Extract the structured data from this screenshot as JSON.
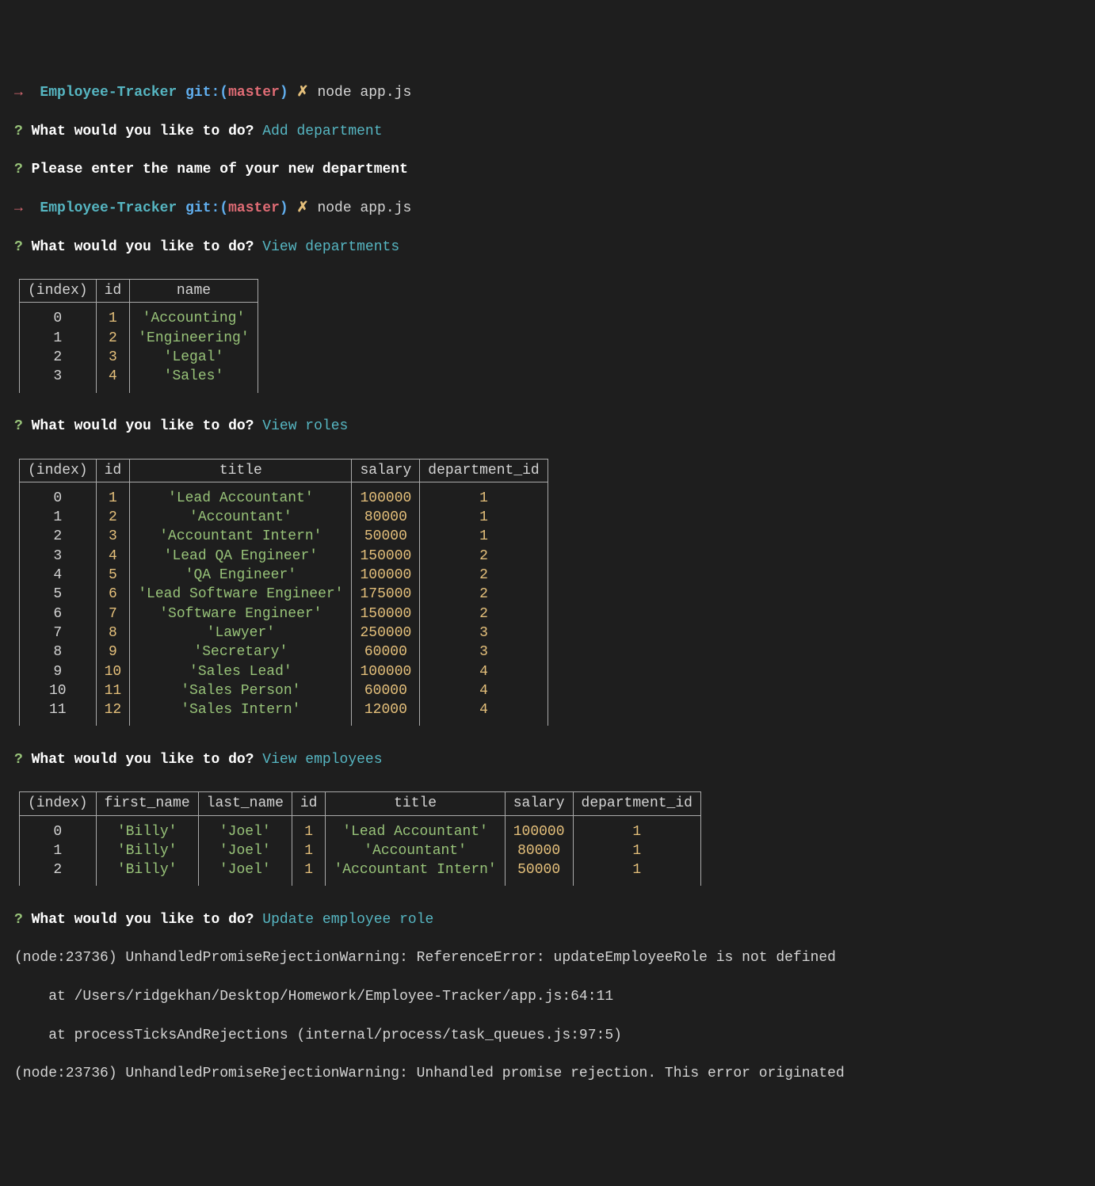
{
  "prompt1": {
    "arrow": "→",
    "project": "Employee-Tracker",
    "git_label": "git:",
    "open_paren": "(",
    "branch": "master",
    "close_paren": ")",
    "dirty": "✗",
    "command": "node app.js"
  },
  "q1": {
    "mark": "?",
    "question": "What would you like to do?",
    "answer": "Add department"
  },
  "q2": {
    "mark": "?",
    "question": "Please enter the name of your new department"
  },
  "prompt2": {
    "arrow": "→",
    "project": "Employee-Tracker",
    "git_label": "git:",
    "open_paren": "(",
    "branch": "master",
    "close_paren": ")",
    "dirty": "✗",
    "command": "node app.js"
  },
  "q3": {
    "mark": "?",
    "question": "What would you like to do?",
    "answer": "View departments"
  },
  "table_departments": {
    "headers": [
      "(index)",
      "id",
      "name"
    ],
    "rows": [
      {
        "index": "0",
        "id": "1",
        "name": "'Accounting'"
      },
      {
        "index": "1",
        "id": "2",
        "name": "'Engineering'"
      },
      {
        "index": "2",
        "id": "3",
        "name": "'Legal'"
      },
      {
        "index": "3",
        "id": "4",
        "name": "'Sales'"
      }
    ]
  },
  "q4": {
    "mark": "?",
    "question": "What would you like to do?",
    "answer": "View roles"
  },
  "table_roles": {
    "headers": [
      "(index)",
      "id",
      "title",
      "salary",
      "department_id"
    ],
    "rows": [
      {
        "index": "0",
        "id": "1",
        "title": "'Lead Accountant'",
        "salary": "100000",
        "dept": "1"
      },
      {
        "index": "1",
        "id": "2",
        "title": "'Accountant'",
        "salary": "80000",
        "dept": "1"
      },
      {
        "index": "2",
        "id": "3",
        "title": "'Accountant Intern'",
        "salary": "50000",
        "dept": "1"
      },
      {
        "index": "3",
        "id": "4",
        "title": "'Lead QA Engineer'",
        "salary": "150000",
        "dept": "2"
      },
      {
        "index": "4",
        "id": "5",
        "title": "'QA Engineer'",
        "salary": "100000",
        "dept": "2"
      },
      {
        "index": "5",
        "id": "6",
        "title": "'Lead Software Engineer'",
        "salary": "175000",
        "dept": "2"
      },
      {
        "index": "6",
        "id": "7",
        "title": "'Software Engineer'",
        "salary": "150000",
        "dept": "2"
      },
      {
        "index": "7",
        "id": "8",
        "title": "'Lawyer'",
        "salary": "250000",
        "dept": "3"
      },
      {
        "index": "8",
        "id": "9",
        "title": "'Secretary'",
        "salary": "60000",
        "dept": "3"
      },
      {
        "index": "9",
        "id": "10",
        "title": "'Sales Lead'",
        "salary": "100000",
        "dept": "4"
      },
      {
        "index": "10",
        "id": "11",
        "title": "'Sales Person'",
        "salary": "60000",
        "dept": "4"
      },
      {
        "index": "11",
        "id": "12",
        "title": "'Sales Intern'",
        "salary": "12000",
        "dept": "4"
      }
    ]
  },
  "q5": {
    "mark": "?",
    "question": "What would you like to do?",
    "answer": "View employees"
  },
  "table_employees": {
    "headers": [
      "(index)",
      "first_name",
      "last_name",
      "id",
      "title",
      "salary",
      "department_id"
    ],
    "rows": [
      {
        "index": "0",
        "first": "'Billy'",
        "last": "'Joel'",
        "id": "1",
        "title": "'Lead Accountant'",
        "salary": "100000",
        "dept": "1"
      },
      {
        "index": "1",
        "first": "'Billy'",
        "last": "'Joel'",
        "id": "1",
        "title": "'Accountant'",
        "salary": "80000",
        "dept": "1"
      },
      {
        "index": "2",
        "first": "'Billy'",
        "last": "'Joel'",
        "id": "1",
        "title": "'Accountant Intern'",
        "salary": "50000",
        "dept": "1"
      }
    ]
  },
  "q6": {
    "mark": "?",
    "question": "What would you like to do?",
    "answer": "Update employee role"
  },
  "errors": {
    "line1": "(node:23736) UnhandledPromiseRejectionWarning: ReferenceError: updateEmployeeRole is not defined",
    "line2": "    at /Users/ridgekhan/Desktop/Homework/Employee-Tracker/app.js:64:11",
    "line3": "    at processTicksAndRejections (internal/process/task_queues.js:97:5)",
    "line4": "(node:23736) UnhandledPromiseRejectionWarning: Unhandled promise rejection. This error originated"
  }
}
